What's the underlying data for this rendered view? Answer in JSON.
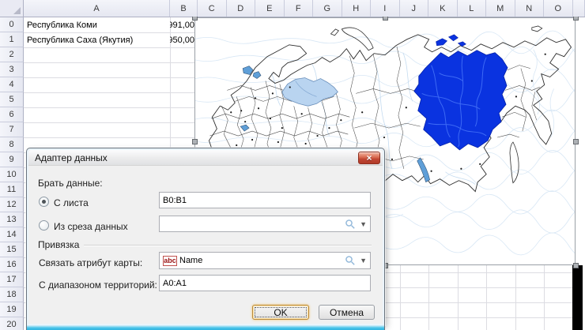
{
  "spreadsheet": {
    "column_headers": [
      "A",
      "B",
      "C",
      "D",
      "E",
      "F",
      "G",
      "H",
      "I",
      "J",
      "K",
      "L",
      "M",
      "N",
      "O"
    ],
    "row_headers": [
      "0",
      "1",
      "2",
      "3",
      "4",
      "5",
      "6",
      "7",
      "8",
      "9",
      "10",
      "11",
      "12",
      "13",
      "14",
      "15",
      "16",
      "17",
      "18",
      "19",
      "20"
    ],
    "cells": [
      {
        "col": "A",
        "row": 0,
        "text": "Республика Коми",
        "align": "left"
      },
      {
        "col": "B",
        "row": 0,
        "text": "991,00",
        "align": "right"
      },
      {
        "col": "A",
        "row": 1,
        "text": "Республика Саха (Якутия)",
        "align": "left"
      },
      {
        "col": "B",
        "row": 1,
        "text": "950,00",
        "align": "right"
      }
    ]
  },
  "map": {
    "highlighted_regions": [
      "Республика Саха (Якутия)",
      "Республика Коми"
    ],
    "colors": {
      "selected_region": "#0a33e0",
      "selected_region_border": "#0521a8",
      "river_on_selected": "#3d6af5",
      "secondary_region": "#b9d4f0",
      "secondary_region_border": "#6a8fba",
      "contour": "#d8e7f5",
      "land_river": "#c4dbf0",
      "region_border": "#4a4a4a",
      "coastline": "#2e2e2e",
      "lake": "#5f9fd8"
    }
  },
  "dialog": {
    "title": "Адаптер данных",
    "close_glyph": "×",
    "take_data_label": "Брать данные:",
    "from_sheet": {
      "label": "С листа",
      "value": "B0:B1",
      "selected": true
    },
    "from_slice": {
      "label": "Из среза данных",
      "value": "",
      "selected": false
    },
    "binding_label": "Привязка",
    "map_attribute": {
      "label": "Связать атрибут карты:",
      "icon_text": "abc",
      "value": "Name"
    },
    "territory_range": {
      "label": "С диапазоном территорий:",
      "value": "A0:A1"
    },
    "buttons": {
      "ok": "OK",
      "cancel": "Отмена"
    }
  }
}
